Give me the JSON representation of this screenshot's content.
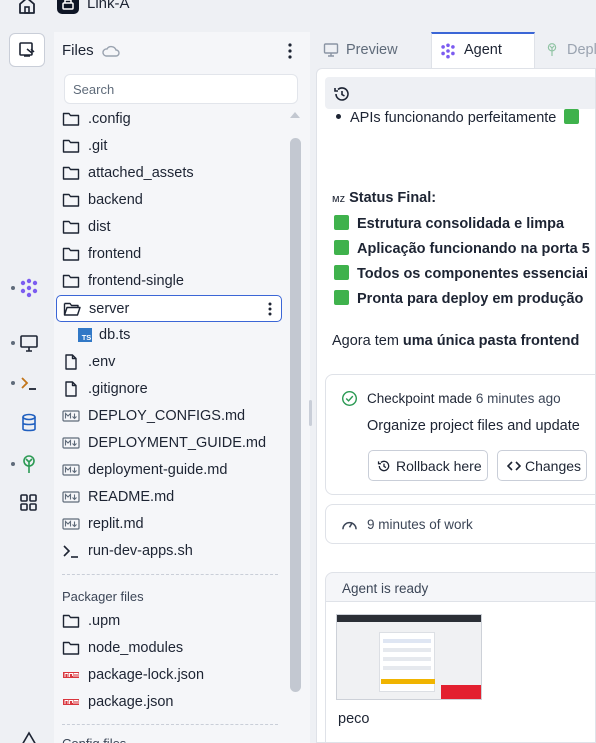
{
  "topbar": {
    "app_name": "Link-A"
  },
  "files": {
    "title": "Files",
    "search_placeholder": "Search",
    "items": [
      {
        "name": ".config",
        "type": "folder"
      },
      {
        "name": ".git",
        "type": "folder"
      },
      {
        "name": "attached_assets",
        "type": "folder"
      },
      {
        "name": "backend",
        "type": "folder"
      },
      {
        "name": "dist",
        "type": "folder"
      },
      {
        "name": "frontend",
        "type": "folder"
      },
      {
        "name": "frontend-single",
        "type": "folder"
      },
      {
        "name": "server",
        "type": "folder-open"
      },
      {
        "name": "db.ts",
        "type": "ts"
      },
      {
        "name": ".env",
        "type": "file"
      },
      {
        "name": ".gitignore",
        "type": "file"
      },
      {
        "name": "DEPLOY_CONFIGS.md",
        "type": "md"
      },
      {
        "name": "DEPLOYMENT_GUIDE.md",
        "type": "md"
      },
      {
        "name": "deployment-guide.md",
        "type": "md"
      },
      {
        "name": "README.md",
        "type": "md"
      },
      {
        "name": "replit.md",
        "type": "md"
      },
      {
        "name": "run-dev-apps.sh",
        "type": "shell"
      }
    ],
    "packager_header": "Packager files",
    "packager_items": [
      {
        "name": ".upm",
        "type": "folder"
      },
      {
        "name": "node_modules",
        "type": "folder"
      },
      {
        "name": "package-lock.json",
        "type": "npm"
      },
      {
        "name": "package.json",
        "type": "npm"
      }
    ],
    "config_header": "Config files"
  },
  "tabs": [
    {
      "label": "Preview",
      "icon": "monitor-icon",
      "active": false
    },
    {
      "label": "Agent",
      "icon": "agent-icon",
      "active": true
    },
    {
      "label": "Depl",
      "icon": "deploy-icon",
      "active": false
    }
  ],
  "chat": {
    "bullet_line": "APIs funcionando perfeitamente",
    "status_prefix": "ᴍᴢ",
    "status_title": "Status Final:",
    "checklist": [
      "Estrutura consolidada e limpa",
      "Aplicação funcionando na porta 5",
      "Todos os componentes essenciai",
      "Pronta para deploy em produção"
    ],
    "summary_normal": "Agora tem ",
    "summary_bold": "uma única pasta frontend",
    "checkpoint_label": "Checkpoint made",
    "checkpoint_time": "6 minutes ago",
    "checkpoint_desc": "Organize project files and update",
    "rollback_label": "Rollback here",
    "changes_label": "Changes",
    "work_time": "9 minutes of work",
    "agent_ready": "Agent is ready",
    "thumb_name": "peco"
  },
  "colors": {
    "accent": "#3b66d6",
    "agent_purple": "#7c5cf0",
    "check_green": "#3fb24c",
    "deploy_green": "#2c9a54",
    "npm_red": "#d9363e"
  }
}
